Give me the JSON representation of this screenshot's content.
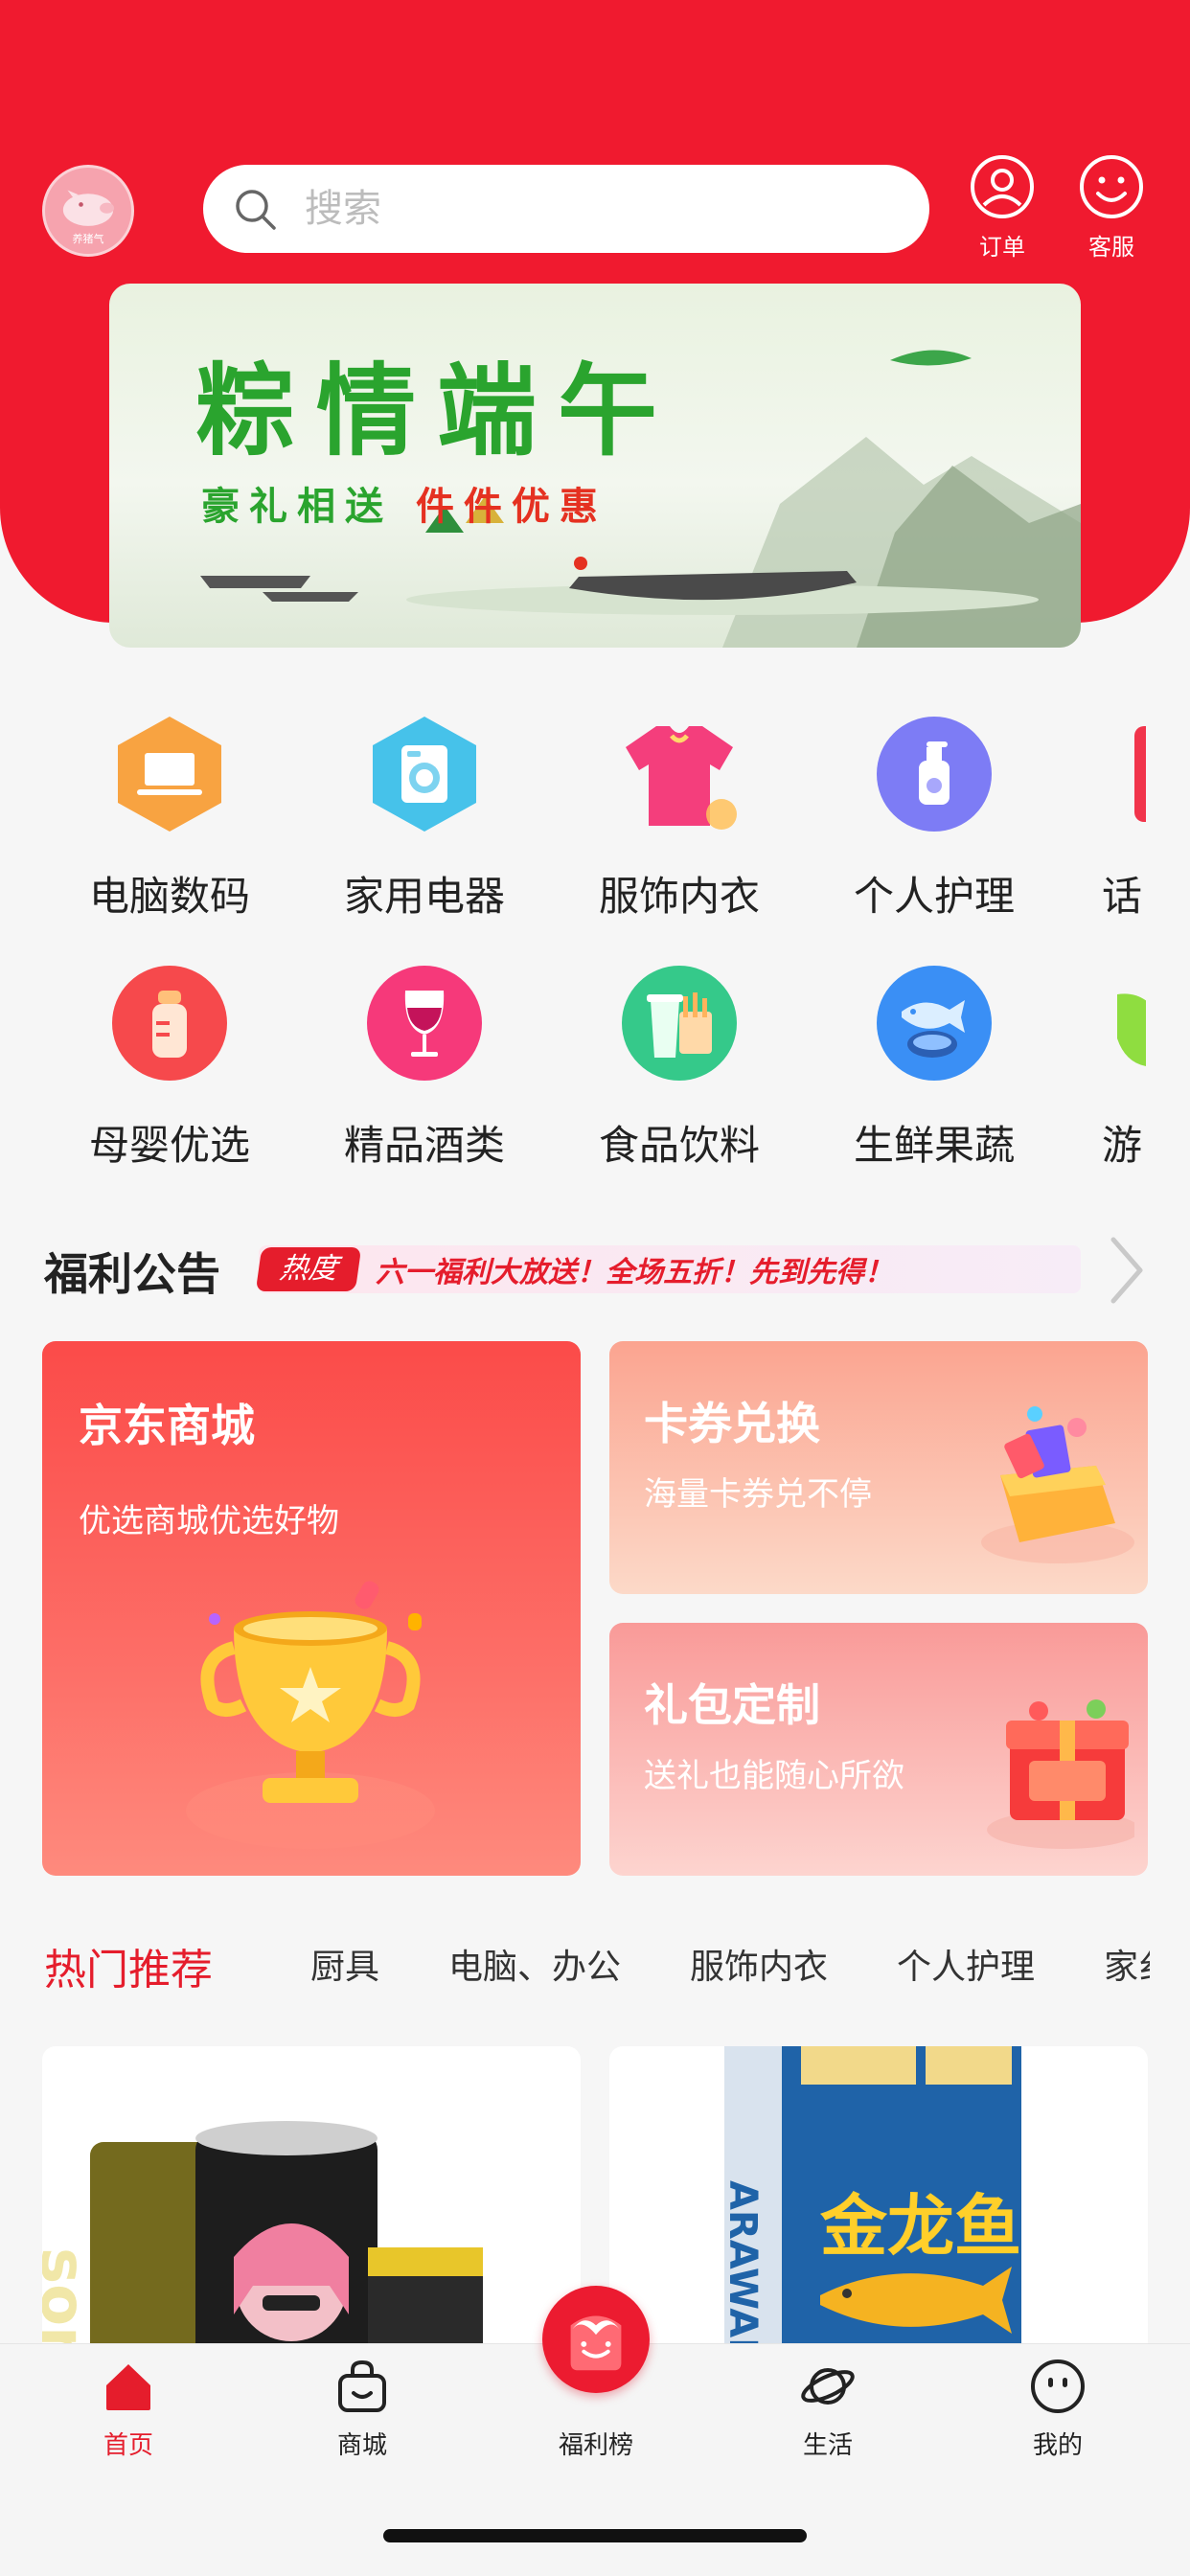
{
  "header": {
    "avatar_text": "养猪气",
    "search_placeholder": "搜索",
    "order_label": "订单",
    "service_label": "客服"
  },
  "banner": {
    "title": "粽情端午",
    "subtitle_green": "豪礼相送 ",
    "subtitle_red": "件件优惠"
  },
  "categories": {
    "row1": [
      {
        "label": "电脑数码",
        "icon": "laptop-icon",
        "color": "#f8a341"
      },
      {
        "label": "家用电器",
        "icon": "washing-machine-icon",
        "color": "#46c2ea"
      },
      {
        "label": "服饰内衣",
        "icon": "tshirt-icon",
        "color": "#f43e7c"
      },
      {
        "label": "个人护理",
        "icon": "lotion-bottle-icon",
        "color": "#7d7cf5"
      },
      {
        "label": "话",
        "icon": "phone-icon",
        "color": "#f1344b"
      }
    ],
    "row2": [
      {
        "label": "母婴优选",
        "icon": "baby-bottle-icon",
        "color": "#f6494c"
      },
      {
        "label": "精品酒类",
        "icon": "wine-glass-icon",
        "color": "#f6397a"
      },
      {
        "label": "食品饮料",
        "icon": "food-drink-icon",
        "color": "#35c98a"
      },
      {
        "label": "生鲜果蔬",
        "icon": "fish-vegetable-icon",
        "color": "#3a8ff5"
      },
      {
        "label": "游",
        "icon": "game-icon",
        "color": "#8fdd40"
      }
    ]
  },
  "notice": {
    "title": "福利公告",
    "badge": "热度",
    "text": "六一福利大放送！全场五折！先到先得！"
  },
  "cards": {
    "big": {
      "title": "京东商城",
      "subtitle": "优选商城优选好物"
    },
    "coupon": {
      "title": "卡券兑换",
      "subtitle": "海量卡券兑不停"
    },
    "gift": {
      "title": "礼包定制",
      "subtitle": "送礼也能随心所欲"
    }
  },
  "hot": {
    "title": "热门推荐",
    "tabs": [
      "厨具",
      "电脑、办公",
      "服饰内衣",
      "个人护理",
      "家纟"
    ]
  },
  "products": {
    "p1_brand": "son's",
    "p2_brand": "金龙鱼",
    "p2_side": "ARAWANA"
  },
  "tabbar": {
    "home": "首页",
    "mall": "商城",
    "welfare": "福利榜",
    "life": "生活",
    "mine": "我的"
  },
  "colors": {
    "brand_red": "#f01a2f",
    "accent_red": "#e51d2c"
  }
}
